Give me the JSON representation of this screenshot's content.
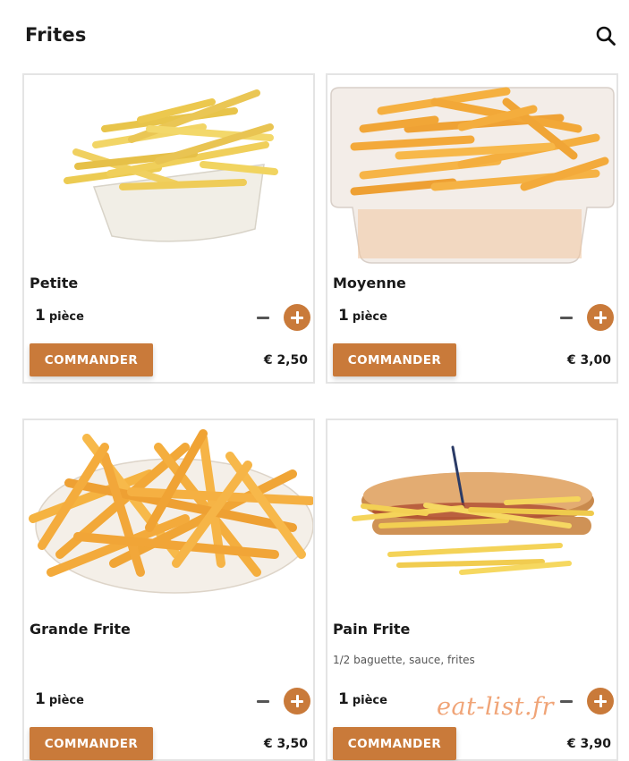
{
  "header": {
    "title": "Frites",
    "search_icon": "search-icon"
  },
  "accent_color": "#c97a3a",
  "products": [
    {
      "name": "Petite",
      "description": "",
      "quantity": "1",
      "unit": "pièce",
      "order_label": "COMMANDER",
      "price": "€ 2,50"
    },
    {
      "name": "Moyenne",
      "description": "",
      "quantity": "1",
      "unit": "pièce",
      "order_label": "COMMANDER",
      "price": "€ 3,00"
    },
    {
      "name": "Grande Frite",
      "description": "",
      "quantity": "1",
      "unit": "pièce",
      "order_label": "COMMANDER",
      "price": "€ 3,50"
    },
    {
      "name": "Pain Frite",
      "description": "1/2 baguette, sauce, frites",
      "quantity": "1",
      "unit": "pièce",
      "order_label": "COMMANDER",
      "price": "€ 3,90"
    }
  ],
  "watermark": "eat-list.fr"
}
